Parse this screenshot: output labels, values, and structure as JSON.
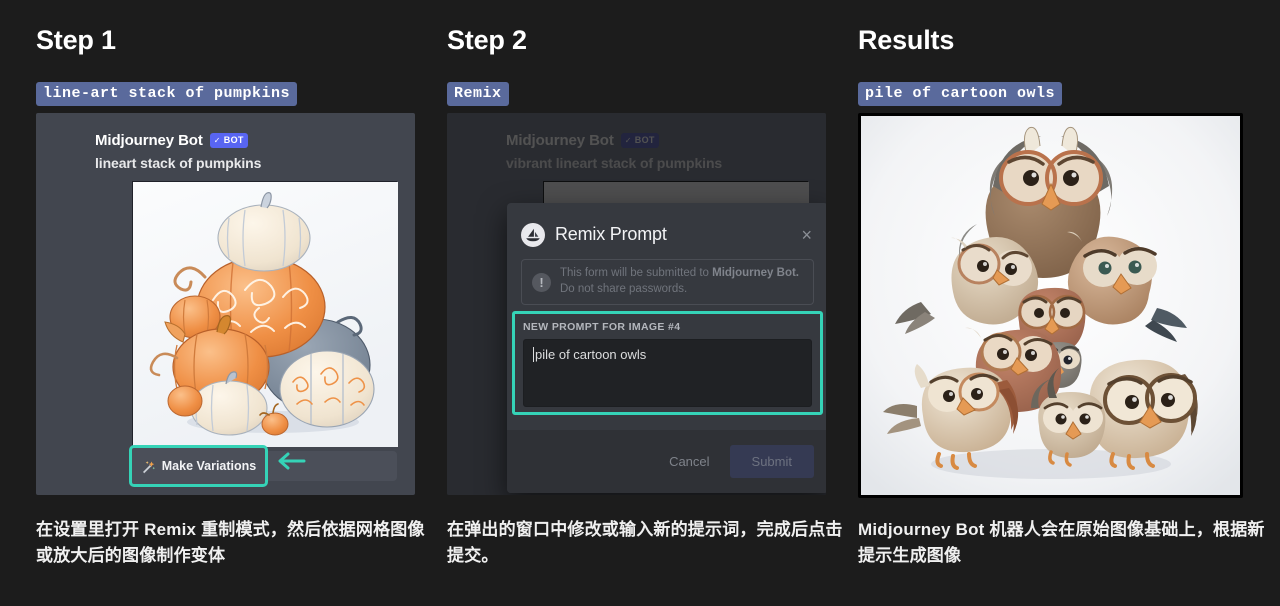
{
  "columns": [
    {
      "title": "Step 1",
      "chip": "line-art stack of pumpkins",
      "message": {
        "bot_name": "Midjourney Bot",
        "badge_check": "✓",
        "badge_label": "BOT",
        "prompt": "lineart stack of pumpkins"
      },
      "artwork": "line-art stack of pumpkins illustration",
      "button": {
        "icon": "magic-wand-icon",
        "label": "Make Variations"
      },
      "annotation": "teal-arrow-pointing-left",
      "caption": "在设置里打开 Remix 重制模式，然后依据网格图像或放大后的图像制作变体"
    },
    {
      "title": "Step 2",
      "chip": "Remix",
      "message": {
        "bot_name": "Midjourney Bot",
        "badge_check": "✓",
        "badge_label": "BOT",
        "prompt": "vibrant lineart stack of pumpkins"
      },
      "modal": {
        "avatar_icon": "midjourney-sailboat-icon",
        "title": "Remix Prompt",
        "close_icon": "×",
        "warning_icon": "!",
        "warning_line1_pre": "This form will be submitted to ",
        "warning_line1_bold": "Midjourney Bot.",
        "warning_line2": "Do not share passwords.",
        "field_label": "NEW PROMPT FOR IMAGE #4",
        "field_value": "pile of cartoon owls",
        "cancel_label": "Cancel",
        "submit_label": "Submit"
      },
      "caption": "在弹出的窗口中修改或输入新的提示词，完成后点击提交。"
    },
    {
      "title": "Results",
      "chip": "pile of cartoon owls",
      "artwork": "pile of cartoon owls illustration",
      "caption": "Midjourney Bot 机器人会在原始图像基础上，根据新提示生成图像"
    }
  ],
  "colors": {
    "background": "#1c1c1c",
    "chip_blue": "#5a6a9c",
    "panel_gray": "#42464f",
    "highlight_teal": "#35d3b7",
    "discord_blurple": "#5865f2"
  }
}
